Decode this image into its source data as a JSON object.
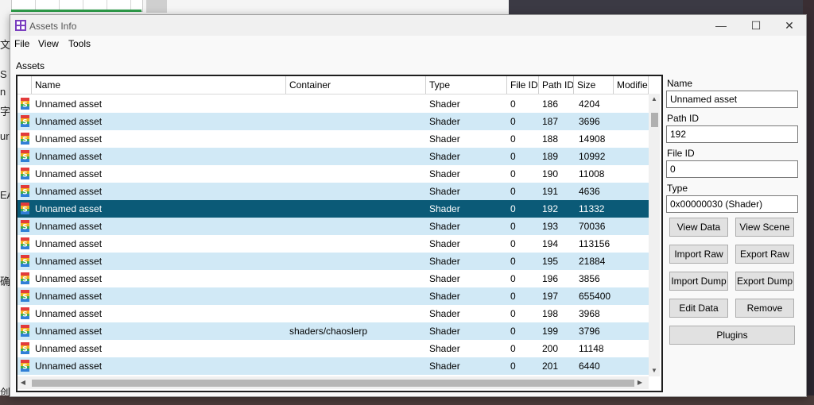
{
  "window": {
    "title": "Assets Info",
    "controls": {
      "minimize": "—",
      "maximize": "☐",
      "close": "✕"
    }
  },
  "menu": [
    "File",
    "View",
    "Tools"
  ],
  "assets_label": "Assets",
  "table": {
    "columns": [
      "Name",
      "Container",
      "Type",
      "File ID",
      "Path ID",
      "Size",
      "Modifie"
    ],
    "rows": [
      {
        "name": "Unnamed asset",
        "container": "",
        "type": "Shader",
        "file_id": "0",
        "path_id": "186",
        "size": "4204"
      },
      {
        "name": "Unnamed asset",
        "container": "",
        "type": "Shader",
        "file_id": "0",
        "path_id": "187",
        "size": "3696"
      },
      {
        "name": "Unnamed asset",
        "container": "",
        "type": "Shader",
        "file_id": "0",
        "path_id": "188",
        "size": "14908"
      },
      {
        "name": "Unnamed asset",
        "container": "",
        "type": "Shader",
        "file_id": "0",
        "path_id": "189",
        "size": "10992"
      },
      {
        "name": "Unnamed asset",
        "container": "",
        "type": "Shader",
        "file_id": "0",
        "path_id": "190",
        "size": "11008"
      },
      {
        "name": "Unnamed asset",
        "container": "",
        "type": "Shader",
        "file_id": "0",
        "path_id": "191",
        "size": "4636"
      },
      {
        "name": "Unnamed asset",
        "container": "",
        "type": "Shader",
        "file_id": "0",
        "path_id": "192",
        "size": "11332"
      },
      {
        "name": "Unnamed asset",
        "container": "",
        "type": "Shader",
        "file_id": "0",
        "path_id": "193",
        "size": "70036"
      },
      {
        "name": "Unnamed asset",
        "container": "",
        "type": "Shader",
        "file_id": "0",
        "path_id": "194",
        "size": "113156"
      },
      {
        "name": "Unnamed asset",
        "container": "",
        "type": "Shader",
        "file_id": "0",
        "path_id": "195",
        "size": "21884"
      },
      {
        "name": "Unnamed asset",
        "container": "",
        "type": "Shader",
        "file_id": "0",
        "path_id": "196",
        "size": "3856"
      },
      {
        "name": "Unnamed asset",
        "container": "",
        "type": "Shader",
        "file_id": "0",
        "path_id": "197",
        "size": "655400"
      },
      {
        "name": "Unnamed asset",
        "container": "",
        "type": "Shader",
        "file_id": "0",
        "path_id": "198",
        "size": "3968"
      },
      {
        "name": "Unnamed asset",
        "container": "shaders/chaoslerp",
        "type": "Shader",
        "file_id": "0",
        "path_id": "199",
        "size": "3796"
      },
      {
        "name": "Unnamed asset",
        "container": "",
        "type": "Shader",
        "file_id": "0",
        "path_id": "200",
        "size": "11148"
      },
      {
        "name": "Unnamed asset",
        "container": "",
        "type": "Shader",
        "file_id": "0",
        "path_id": "201",
        "size": "6440"
      }
    ],
    "selected_row": 6
  },
  "details": {
    "name_label": "Name",
    "name_value": "Unnamed asset",
    "path_id_label": "Path ID",
    "path_id_value": "192",
    "file_id_label": "File ID",
    "file_id_value": "0",
    "type_label": "Type",
    "type_value": "0x00000030 (Shader)"
  },
  "buttons": {
    "view_data": "View Data",
    "view_scene": "View Scene",
    "import_raw": "Import Raw",
    "export_raw": "Export Raw",
    "import_dump": "Import Dump",
    "export_dump": "Export Dump",
    "edit_data": "Edit Data",
    "remove": "Remove",
    "plugins": "Plugins"
  },
  "background_text": [
    "文",
    "S",
    "n",
    "字",
    "ur",
    "EA",
    "确",
    "创"
  ],
  "colors": {
    "selection": "#0b5a77",
    "alt_row": "#d1e9f6"
  },
  "icons": {
    "app": "app-icon",
    "row": "shader-icon"
  }
}
